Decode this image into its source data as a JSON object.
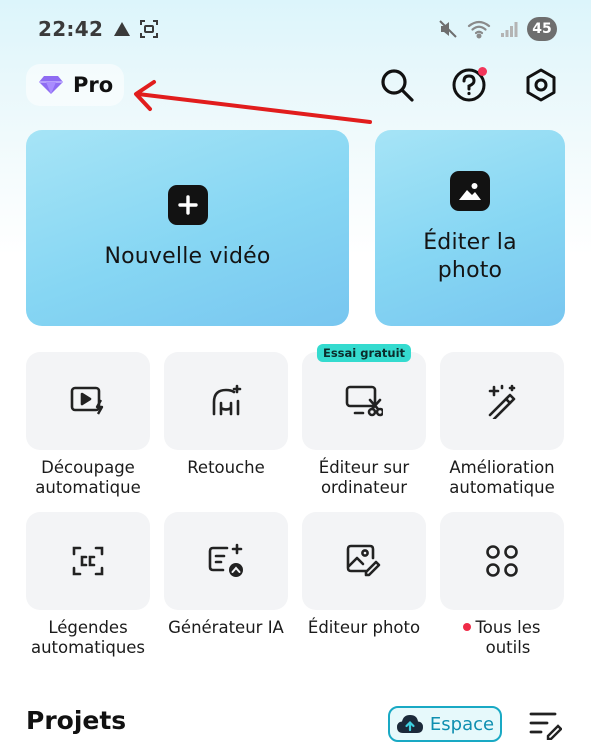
{
  "status_bar": {
    "time": "22:42",
    "battery": "45"
  },
  "header": {
    "pro_label": "Pro"
  },
  "cards": {
    "new_video": "Nouvelle vidéo",
    "edit_photo": "Éditer la photo"
  },
  "tools": [
    {
      "label": "Découpage\nautomatique"
    },
    {
      "label": "Retouche"
    },
    {
      "label": "Éditeur sur\nordinateur",
      "badge": "Essai gratuit"
    },
    {
      "label": "Amélioration\nautomatique"
    },
    {
      "label": "Légendes\nautomatiques"
    },
    {
      "label": "Générateur IA"
    },
    {
      "label": "Éditeur photo"
    },
    {
      "label": "Tous les\noutils"
    }
  ],
  "projects": {
    "title": "Projets",
    "espace_label": "Espace"
  },
  "colors": {
    "accent": "#19a9c4",
    "card": "#86d6f3",
    "notification": "#f2365a",
    "badge": "#34dbcf"
  }
}
